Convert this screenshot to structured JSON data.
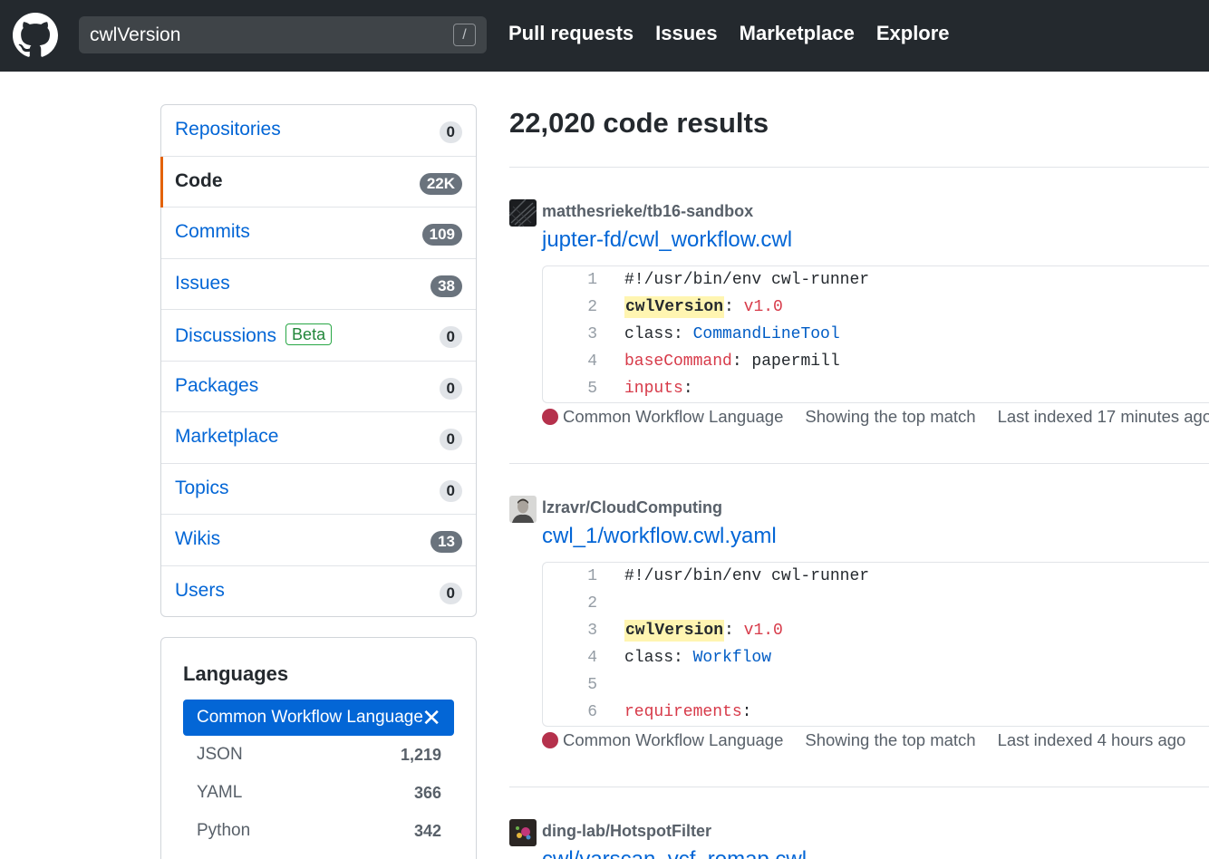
{
  "header": {
    "search_value": "cwlVersion",
    "search_shortcut": "/",
    "nav": [
      "Pull requests",
      "Issues",
      "Marketplace",
      "Explore"
    ]
  },
  "sidebar": {
    "items": [
      {
        "label": "Repositories",
        "count": "0"
      },
      {
        "label": "Code",
        "count": "22K",
        "selected": true
      },
      {
        "label": "Commits",
        "count": "109"
      },
      {
        "label": "Issues",
        "count": "38"
      },
      {
        "label": "Discussions",
        "count": "0",
        "badge": "Beta"
      },
      {
        "label": "Packages",
        "count": "0"
      },
      {
        "label": "Marketplace",
        "count": "0"
      },
      {
        "label": "Topics",
        "count": "0"
      },
      {
        "label": "Wikis",
        "count": "13"
      },
      {
        "label": "Users",
        "count": "0"
      }
    ]
  },
  "languages": {
    "title": "Languages",
    "selected": "Common Workflow Language",
    "close_glyph": "✕",
    "items": [
      {
        "name": "JSON",
        "count": "1,219"
      },
      {
        "name": "YAML",
        "count": "366"
      },
      {
        "name": "Python",
        "count": "342"
      }
    ]
  },
  "main": {
    "title": "22,020 code results",
    "results": [
      {
        "repo": "matthesrieke/tb16-sandbox",
        "file": "jupter-fd/cwl_workflow.cwl",
        "language": "Common Workflow Language",
        "match": "Showing the top match",
        "indexed": "Last indexed 17 minutes ago",
        "lines": [
          {
            "n": "1",
            "text": "#!/usr/bin/env cwl-runner"
          },
          {
            "n": "2",
            "key": "cwlVersion",
            "rest": ": ",
            "val": "v1.0"
          },
          {
            "n": "3",
            "plain": "class: ",
            "ent": "CommandLineTool"
          },
          {
            "n": "4",
            "key": "baseCommand",
            "rest": ": papermill"
          },
          {
            "n": "5",
            "key": "inputs",
            "rest": ":"
          }
        ]
      },
      {
        "repo": "lzravr/CloudComputing",
        "file": "cwl_1/workflow.cwl.yaml",
        "language": "Common Workflow Language",
        "match": "Showing the top match",
        "indexed": "Last indexed 4 hours ago",
        "lines": [
          {
            "n": "1",
            "text": "#!/usr/bin/env cwl-runner"
          },
          {
            "n": "2"
          },
          {
            "n": "3",
            "key": "cwlVersion",
            "rest": ": ",
            "val": "v1.0"
          },
          {
            "n": "4",
            "plain": "class: ",
            "ent": "Workflow"
          },
          {
            "n": "5"
          },
          {
            "n": "6",
            "key": "requirements",
            "rest": ":"
          }
        ]
      },
      {
        "repo": "ding-lab/HotspotFilter",
        "file": "cwl/varscan_vcf_remap.cwl"
      }
    ]
  },
  "colors": {
    "header_bg": "#24292e",
    "link": "#0366d6",
    "selected_accent": "#e36209",
    "cwl_language": "#b5314c",
    "highlight": "#fff5b1"
  }
}
